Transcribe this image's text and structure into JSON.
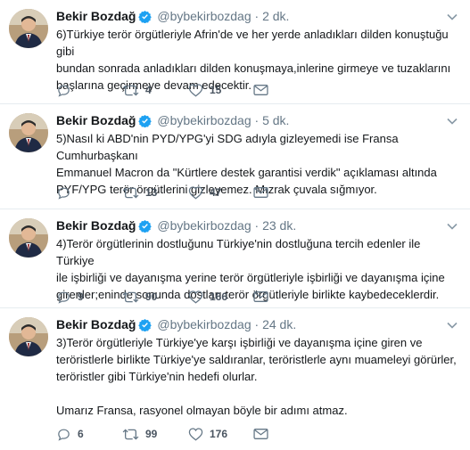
{
  "tweets": [
    {
      "name": "Bekir Bozdağ",
      "handle": "@bybekirbozdag",
      "dot": "·",
      "time": "2 dk.",
      "text": "6)Türkiye terör örgütleriyle Afrin'de ve her yerde anladıkları dilden konuştuğu gibi\nbundan sonrada anladıkları dilden konuşmaya,inlerine girmeye ve tuzaklarını\nbaşlarına geçirmeye devam edecektir.",
      "replies": "",
      "retweets": "4",
      "likes": "15"
    },
    {
      "name": "Bekir Bozdağ",
      "handle": "@bybekirbozdag",
      "dot": "·",
      "time": "5 dk.",
      "text": "5)Nasıl ki ABD'nin PYD/YPG'yi SDG adıyla gizleyemedi ise Fransa Cumhurbaşkanı\nEmmanuel Macron da \"Kürtlere destek garantisi verdik\" açıklaması altında\nPYF/YPG terör örgütlerini gizleyemez. Mızrak çuvala sığmıyor.",
      "replies": "",
      "retweets": "13",
      "likes": "47"
    },
    {
      "name": "Bekir Bozdağ",
      "handle": "@bybekirbozdag",
      "dot": "·",
      "time": "23 dk.",
      "text": "4)Terör örgütlerinin dostluğunu Türkiye'nin dostluğuna tercih edenler ile Türkiye\nile işbirliği ve dayanışma yerine terör örgütleriyle işbirliği ve dayanışma içine\ngirenler;eninde sonunda dostları terör örgütleriyle birlikte kaybedeceklerdir.",
      "replies": "9",
      "retweets": "90",
      "likes": "166"
    },
    {
      "name": "Bekir Bozdağ",
      "handle": "@bybekirbozdag",
      "dot": "·",
      "time": "24 dk.",
      "text": "3)Terör örgütleriyle Türkiye'ye karşı işbirliği ve dayanışma içine giren ve\nteröristlerle birlikte Türkiye'ye saldıranlar, teröristlerle aynı muameleyi görürler,\nteröristler gibi Türkiye'nin hedefi olurlar.\n\nUmarız Fransa, rasyonel olmayan böyle bir adımı atmaz.",
      "replies": "6",
      "retweets": "99",
      "likes": "176"
    }
  ],
  "colors": {
    "verified": "#1da1f2",
    "muted": "#657786",
    "text": "#14171a",
    "divider": "#e6ecf0"
  }
}
